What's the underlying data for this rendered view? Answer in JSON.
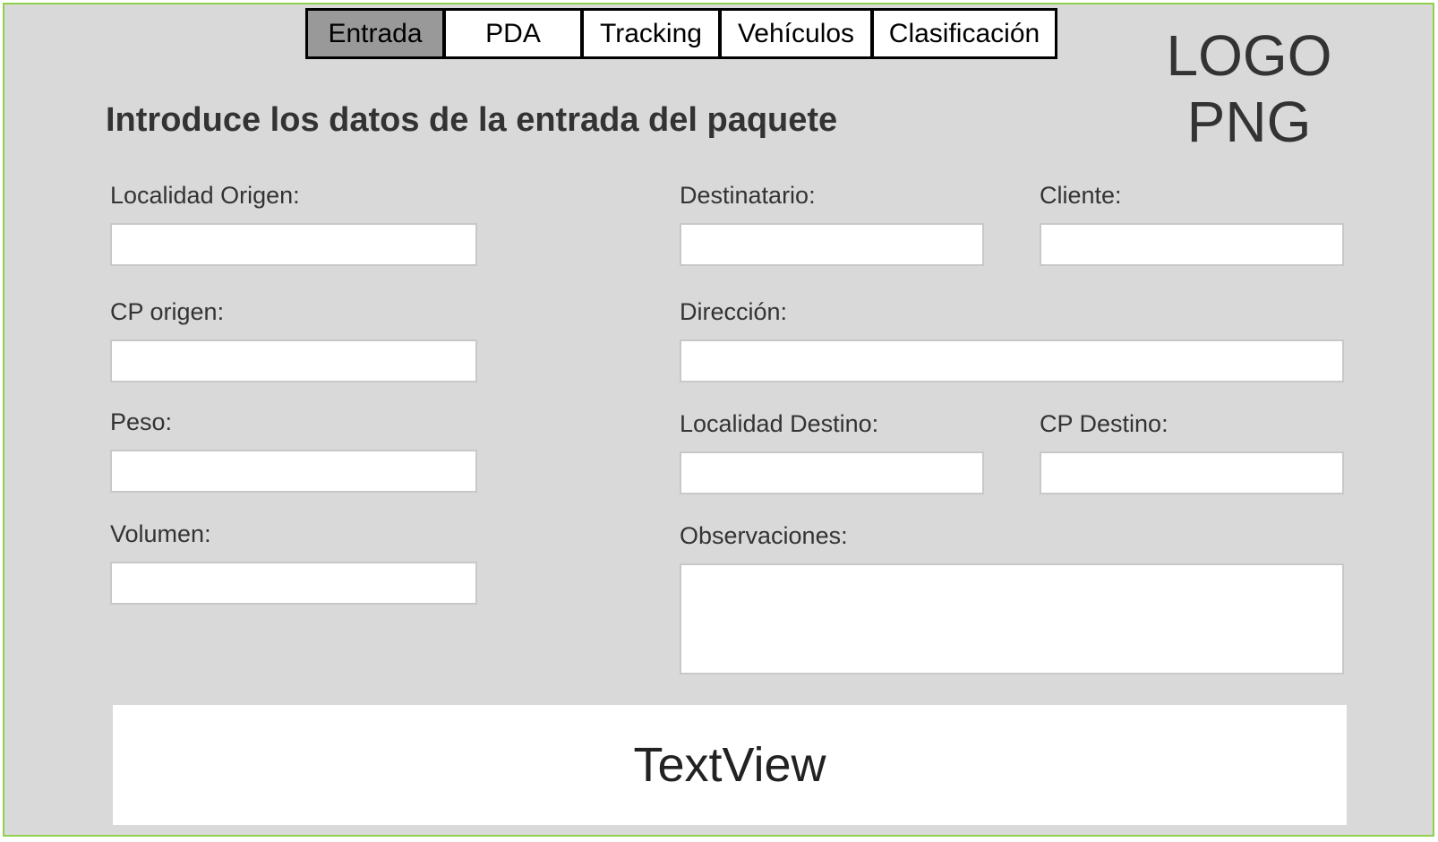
{
  "tabs": [
    {
      "label": "Entrada",
      "active": true
    },
    {
      "label": "PDA",
      "active": false
    },
    {
      "label": "Tracking",
      "active": false
    },
    {
      "label": "Vehículos",
      "active": false
    },
    {
      "label": "Clasificación",
      "active": false
    }
  ],
  "logo": {
    "line1": "LOGO",
    "line2": "PNG"
  },
  "form": {
    "title": "Introduce los datos de la entrada del paquete",
    "localidad_origen": {
      "label": "Localidad Origen:",
      "value": ""
    },
    "cp_origen": {
      "label": "CP origen:",
      "value": ""
    },
    "peso": {
      "label": "Peso:",
      "value": ""
    },
    "volumen": {
      "label": "Volumen:",
      "value": ""
    },
    "destinatario": {
      "label": "Destinatario:",
      "value": ""
    },
    "cliente": {
      "label": "Cliente:",
      "value": ""
    },
    "direccion": {
      "label": "Dirección:",
      "value": ""
    },
    "localidad_destino": {
      "label": "Localidad Destino:",
      "value": ""
    },
    "cp_destino": {
      "label": "CP Destino:",
      "value": ""
    },
    "observaciones": {
      "label": "Observaciones:",
      "value": ""
    }
  },
  "textview": {
    "text": "TextView"
  },
  "colors": {
    "frame_border": "#8fd14f",
    "background": "#d9d9d9",
    "active_tab": "#999999"
  }
}
